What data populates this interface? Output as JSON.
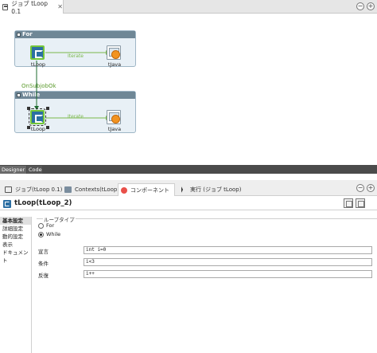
{
  "editor": {
    "tab_title": "ジョブ tLoop 0.1",
    "tab_close": "✕"
  },
  "canvas": {
    "subjob_for": {
      "header": "For",
      "loop_label": "tLoop",
      "java_label": "tJava",
      "link_label": "Iterate"
    },
    "subjob_while": {
      "header": "While",
      "loop_label": "tLoop",
      "java_label": "tJava",
      "link_label": "Iterate"
    },
    "trigger_label": "OnSubjobOk"
  },
  "view_tabs": {
    "designer": "Designer",
    "code": "Code"
  },
  "properties_tabs": {
    "job": "ジョブ(tLoop 0.1)",
    "contexts": "Contexts(tLoop)",
    "component": "コンポーネント",
    "run": "実行 (ジョブ tLoop)"
  },
  "component": {
    "title": "tLoop(tLoop_2)"
  },
  "side_nav": {
    "items": [
      "基本設定",
      "詳細設定",
      "動的設定",
      "表示",
      "ドキュメント"
    ],
    "active_index": 0
  },
  "loop_settings": {
    "group_label": "ループタイプ",
    "options": [
      "For",
      "While"
    ],
    "selected": "While",
    "declaration_label": "宣言",
    "declaration_value": "int i=0",
    "condition_label": "条件",
    "condition_value": "i<3",
    "iteration_label": "反復",
    "iteration_value": "i++"
  },
  "colors": {
    "subjob_header": "#6f8796",
    "subjob_body": "#e8f0f6",
    "link_green": "#7ab84a",
    "loop_blue": "#2c6fa3",
    "java_orange": "#f29320"
  }
}
